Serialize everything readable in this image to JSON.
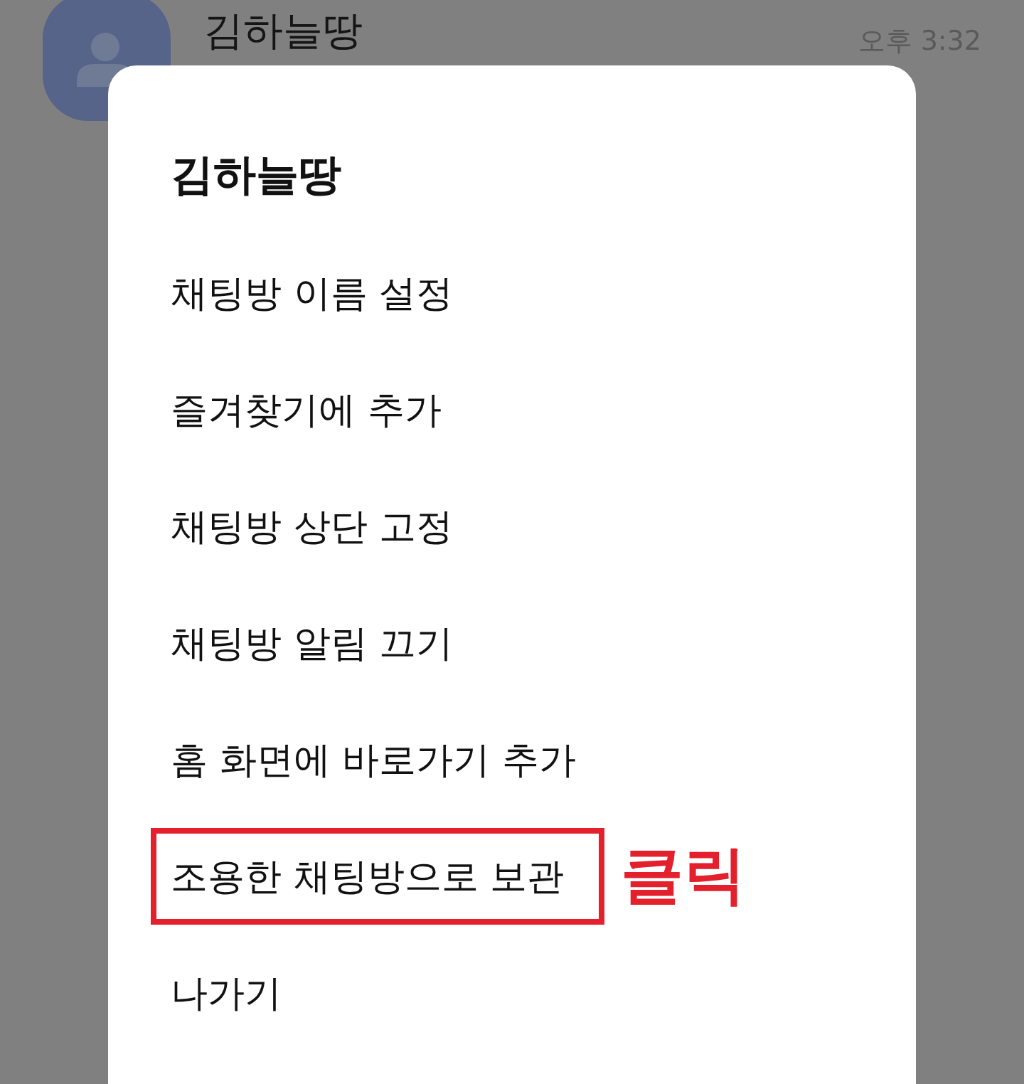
{
  "chat_row": {
    "name": "김하늘땅",
    "time": "오후 3:32"
  },
  "menu": {
    "title": "김하늘땅",
    "items": [
      {
        "label": "채팅방 이름 설정",
        "highlighted": false
      },
      {
        "label": "즐겨찾기에 추가",
        "highlighted": false
      },
      {
        "label": "채팅방 상단 고정",
        "highlighted": false
      },
      {
        "label": "채팅방 알림 끄기",
        "highlighted": false
      },
      {
        "label": "홈 화면에 바로가기 추가",
        "highlighted": false
      },
      {
        "label": "조용한 채팅방으로 보관",
        "highlighted": true,
        "callout": "클릭"
      },
      {
        "label": "나가기",
        "highlighted": false
      }
    ]
  }
}
